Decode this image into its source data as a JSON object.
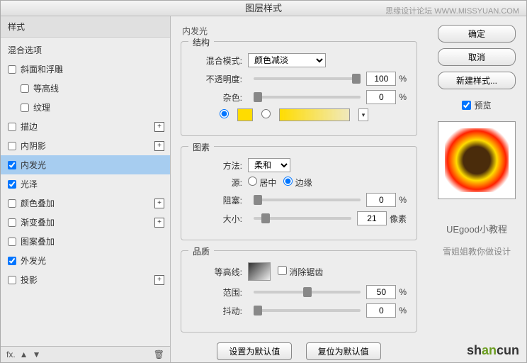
{
  "title": "图层样式",
  "watermark": "思缘设计论坛 WWW.MISSYUAN.COM",
  "left": {
    "header": "样式",
    "blend_options": "混合选项",
    "items": [
      {
        "label": "斜面和浮雕",
        "checked": false,
        "add": false
      },
      {
        "label": "等高线",
        "checked": false,
        "indent": true
      },
      {
        "label": "纹理",
        "checked": false,
        "indent": true
      },
      {
        "label": "描边",
        "checked": false,
        "add": true
      },
      {
        "label": "内阴影",
        "checked": false,
        "add": true
      },
      {
        "label": "内发光",
        "checked": true,
        "selected": true
      },
      {
        "label": "光泽",
        "checked": true
      },
      {
        "label": "颜色叠加",
        "checked": false,
        "add": true
      },
      {
        "label": "渐变叠加",
        "checked": false,
        "add": true
      },
      {
        "label": "图案叠加",
        "checked": false
      },
      {
        "label": "外发光",
        "checked": true
      },
      {
        "label": "投影",
        "checked": false,
        "add": true
      }
    ]
  },
  "center": {
    "panel_title": "内发光",
    "structure": {
      "title": "结构",
      "blend_mode_label": "混合模式:",
      "blend_mode_value": "颜色减淡",
      "opacity_label": "不透明度:",
      "opacity_value": "100",
      "noise_label": "杂色:",
      "noise_value": "0",
      "color_hex": "#ffdc00"
    },
    "elements": {
      "title": "图素",
      "method_label": "方法:",
      "method_value": "柔和",
      "source_label": "源:",
      "source_center": "居中",
      "source_edge": "边缘",
      "choke_label": "阻塞:",
      "choke_value": "0",
      "size_label": "大小:",
      "size_value": "21",
      "size_unit": "像素"
    },
    "quality": {
      "title": "品质",
      "contour_label": "等高线:",
      "antialias": "消除锯齿",
      "range_label": "范围:",
      "range_value": "50",
      "jitter_label": "抖动:",
      "jitter_value": "0"
    },
    "btn_default": "设置为默认值",
    "btn_reset": "复位为默认值",
    "pct": "%"
  },
  "right": {
    "ok": "确定",
    "cancel": "取消",
    "new_style": "新建样式...",
    "preview": "预览",
    "credit1": "UEgood小教程",
    "credit2": "雪姐姐教你做设计"
  },
  "logo": "shancun"
}
